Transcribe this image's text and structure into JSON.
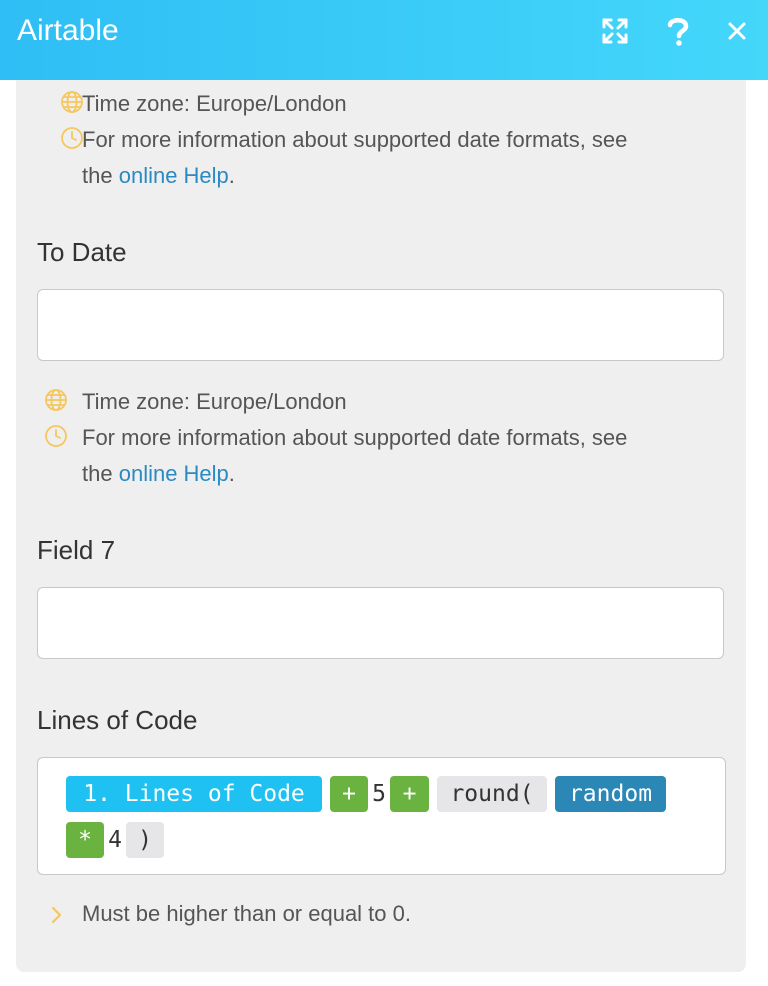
{
  "header": {
    "title": "Airtable"
  },
  "fields": {
    "from_date_info": {
      "timezone": "Time zone: Europe/London",
      "formats_line1": "For more information about supported date formats, see",
      "formats_prefix": "the",
      "help_link": "online Help",
      "formats_suffix": "."
    },
    "to_date": {
      "label": "To Date",
      "value": "",
      "timezone": "Time zone: Europe/London",
      "formats_line1": "For more information about supported date formats, see",
      "formats_prefix": "the",
      "help_link": "online Help",
      "formats_suffix": "."
    },
    "field7": {
      "label": "Field 7",
      "value": ""
    },
    "lines_of_code": {
      "label": "Lines of Code",
      "tokens": [
        "1. Lines of Code",
        "+",
        "5",
        "+",
        "round(",
        "random",
        "*",
        "4",
        ")"
      ],
      "hint": "Must be higher than or equal to 0."
    }
  },
  "colors": {
    "header_start": "#2fbef5",
    "header_end": "#44d7fa",
    "panel": "#efefef",
    "link": "#2b8ac2",
    "icon_accent": "#f5c75e",
    "token_variable": "#1ec1f1",
    "token_operator": "#6ab340",
    "token_function": "#e6e6e8",
    "token_keyword": "#2a87b6"
  },
  "icons": {
    "expand": "expand-icon",
    "help": "help-icon",
    "close": "close-icon",
    "globe": "globe-icon",
    "clock": "clock-icon",
    "chevron": "chevron-right-icon"
  }
}
